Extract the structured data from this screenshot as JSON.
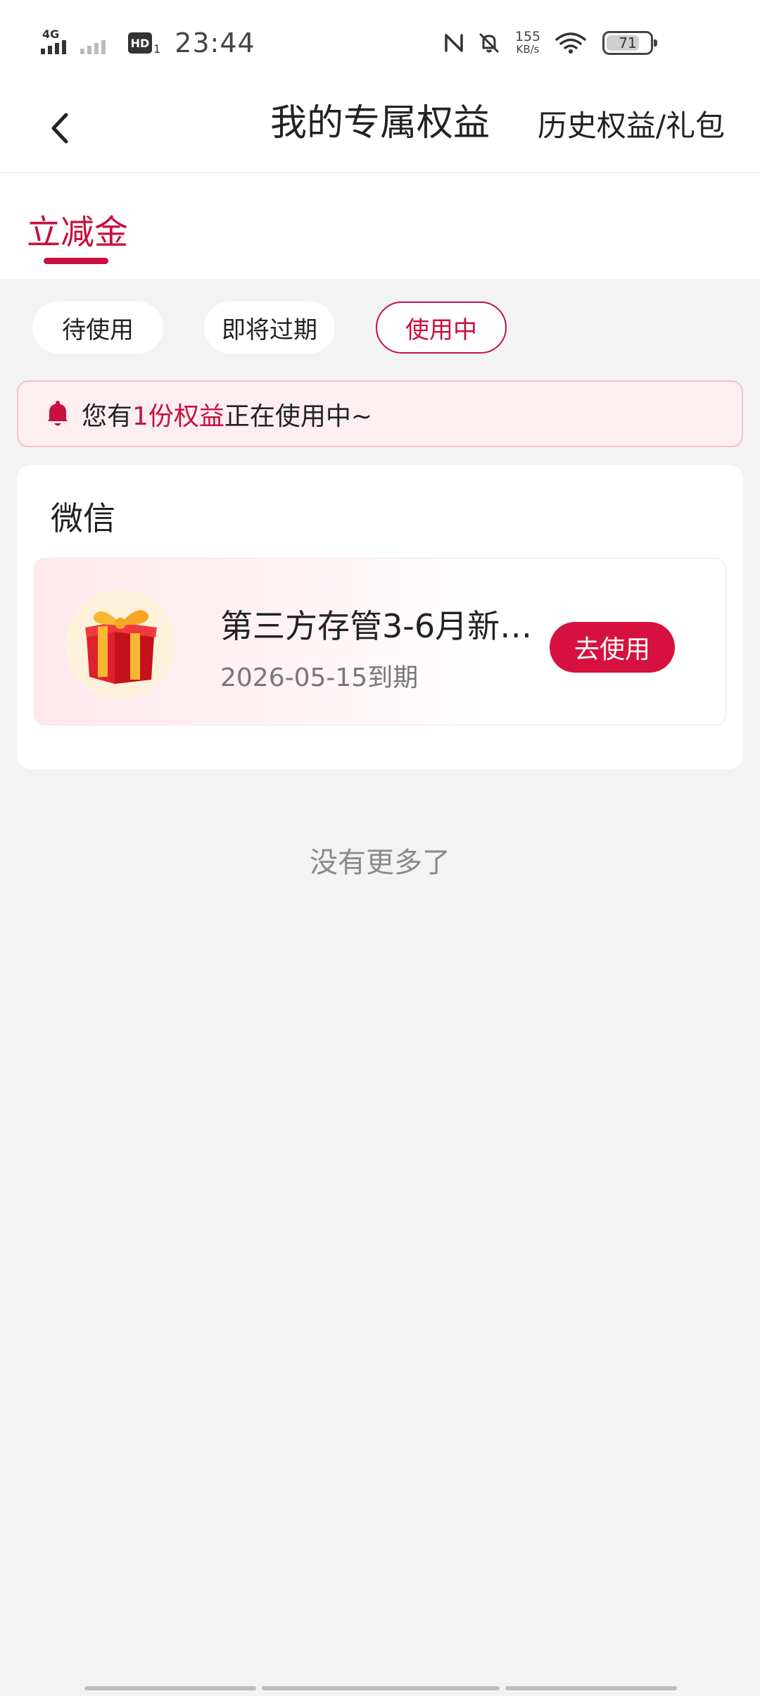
{
  "status_bar": {
    "network": "4G",
    "hd_label": "HD",
    "hd_sub": "1",
    "time": "23:44",
    "speed_value": "155",
    "speed_unit": "KB/s",
    "battery": "71"
  },
  "header": {
    "title": "我的专属权益",
    "history_link": "历史权益/礼包"
  },
  "tab": {
    "label": "立减金"
  },
  "filters": [
    {
      "label": "待使用",
      "active": false
    },
    {
      "label": "即将过期",
      "active": false
    },
    {
      "label": "使用中",
      "active": true
    }
  ],
  "notice": {
    "prefix": "您有",
    "highlight": "1份权益",
    "suffix": "正在使用中~"
  },
  "card": {
    "title": "微信",
    "item": {
      "name": "第三方存管3-6月新…",
      "expiry": "2026-05-15到期",
      "button": "去使用"
    }
  },
  "footer": {
    "no_more": "没有更多了"
  },
  "colors": {
    "accent": "#c8103e",
    "button": "#d7113f",
    "background": "#f3f3f3"
  }
}
